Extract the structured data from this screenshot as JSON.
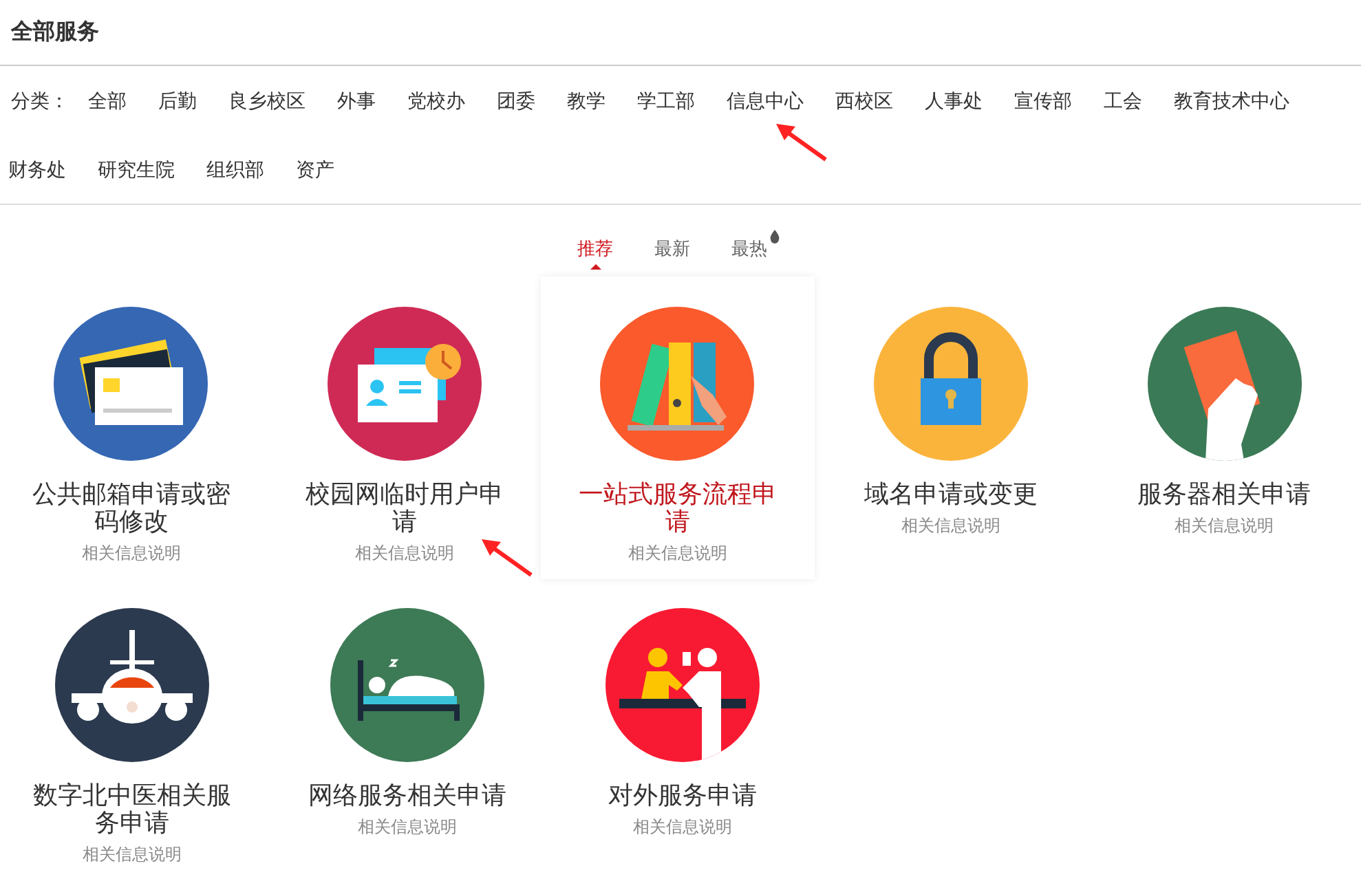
{
  "header": {
    "title": "全部服务"
  },
  "categories": {
    "label": "分类：",
    "items": [
      {
        "label": "全部"
      },
      {
        "label": "后勤"
      },
      {
        "label": "良乡校区"
      },
      {
        "label": "外事"
      },
      {
        "label": "党校办"
      },
      {
        "label": "团委"
      },
      {
        "label": "教学"
      },
      {
        "label": "学工部"
      },
      {
        "label": "信息中心"
      },
      {
        "label": "西校区"
      },
      {
        "label": "人事处"
      },
      {
        "label": "宣传部"
      },
      {
        "label": "工会"
      },
      {
        "label": "教育技术中心"
      },
      {
        "label": "财务处"
      },
      {
        "label": "研究生院"
      },
      {
        "label": "组织部"
      },
      {
        "label": "资产"
      }
    ]
  },
  "sort_tabs": [
    {
      "label": "推荐",
      "selected": true,
      "hot": false
    },
    {
      "label": "最新",
      "selected": false,
      "hot": false
    },
    {
      "label": "最热",
      "selected": false,
      "hot": true
    }
  ],
  "services": [
    {
      "kind": "cards",
      "color": "#3567b3",
      "title": "公共邮箱申请或密码修改",
      "subtitle": "相关信息说明",
      "highlighted": false
    },
    {
      "kind": "idcard",
      "color": "#cf2a55",
      "title": "校园网临时用户申请",
      "subtitle": "相关信息说明",
      "highlighted": false
    },
    {
      "kind": "folders",
      "color": "#fb5a2c",
      "title": "一站式服务流程申请",
      "subtitle": "相关信息说明",
      "highlighted": true
    },
    {
      "kind": "lock",
      "color": "#fbb43b",
      "title": "域名申请或变更",
      "subtitle": "相关信息说明",
      "highlighted": false
    },
    {
      "kind": "pass",
      "color": "#3b7a56",
      "title": "服务器相关申请",
      "subtitle": "相关信息说明",
      "highlighted": false
    },
    {
      "kind": "plane",
      "color": "#2b3a4e",
      "title": "数字北中医相关服务申请",
      "subtitle": "相关信息说明",
      "highlighted": false
    },
    {
      "kind": "bed",
      "color": "#3d7a56",
      "title": "网络服务相关申请",
      "subtitle": "相关信息说明",
      "highlighted": false
    },
    {
      "kind": "desk",
      "color": "#f81a32",
      "title": "对外服务申请",
      "subtitle": "相关信息说明",
      "highlighted": false
    }
  ]
}
